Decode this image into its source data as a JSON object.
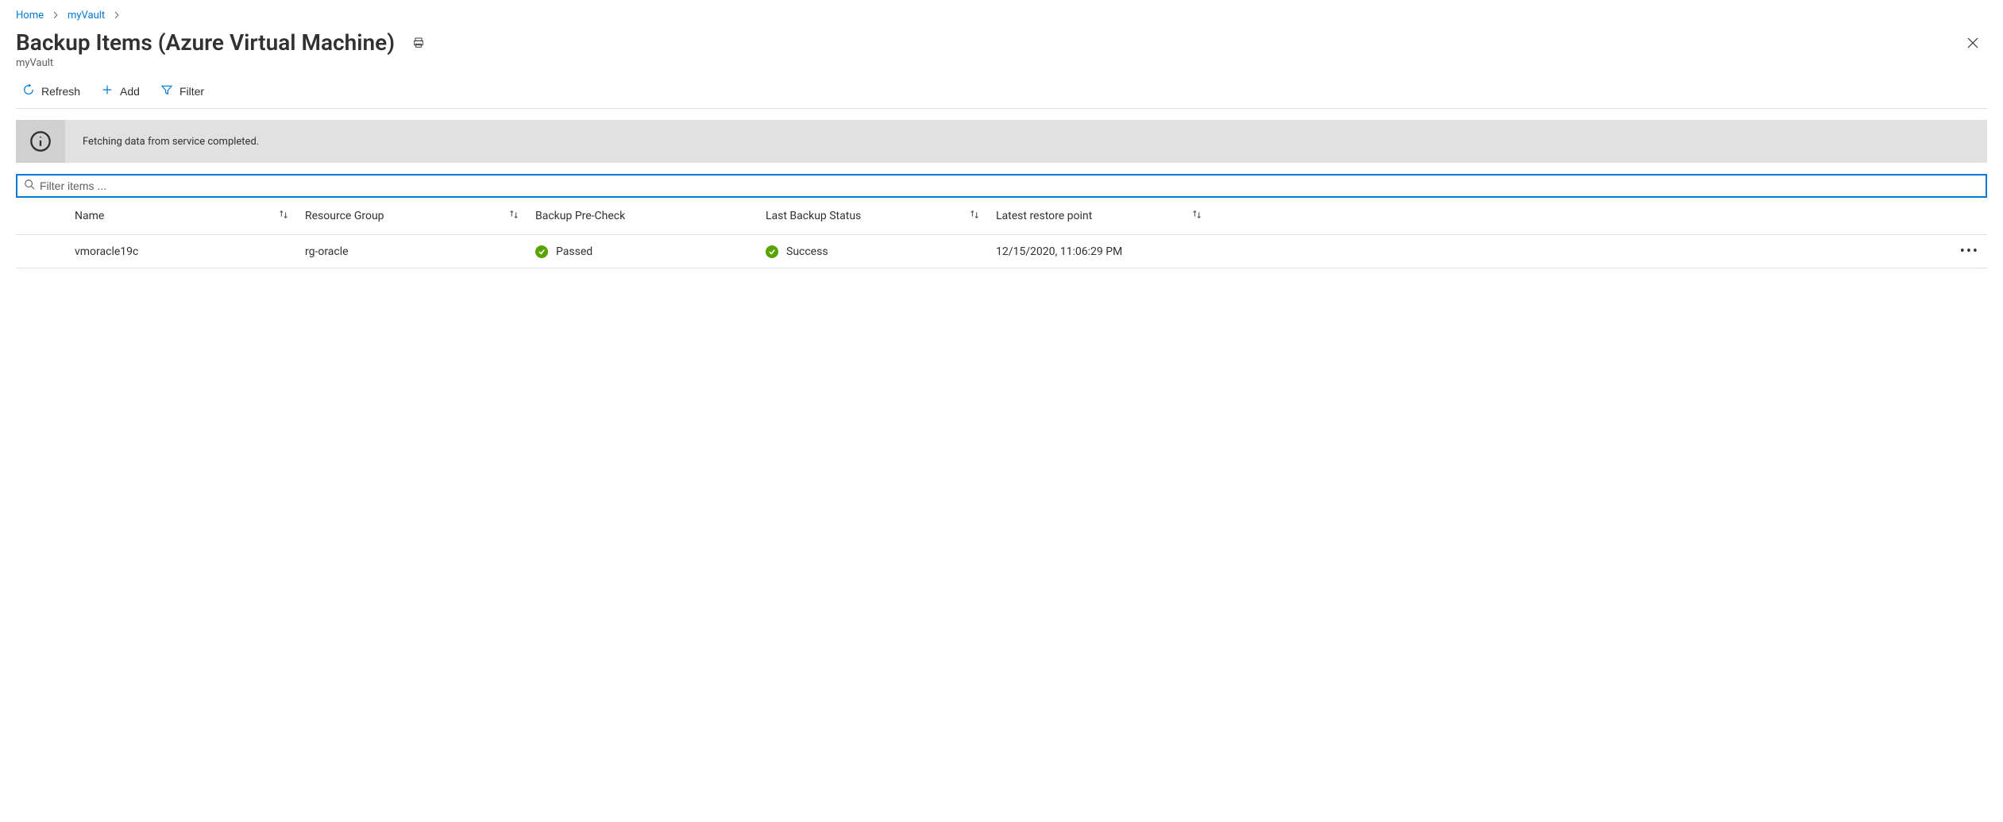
{
  "breadcrumb": {
    "home": "Home",
    "vault": "myVault"
  },
  "header": {
    "title": "Backup Items (Azure Virtual Machine)",
    "subtitle": "myVault"
  },
  "toolbar": {
    "refresh": "Refresh",
    "add": "Add",
    "filter": "Filter"
  },
  "notification": {
    "message": "Fetching data from service completed."
  },
  "filter": {
    "placeholder": "Filter items ..."
  },
  "columns": {
    "name": "Name",
    "resource_group": "Resource Group",
    "precheck": "Backup Pre-Check",
    "last_status": "Last Backup Status",
    "restore_point": "Latest restore point"
  },
  "rows": [
    {
      "name": "vmoracle19c",
      "resource_group": "rg-oracle",
      "precheck_status": "Passed",
      "last_backup_status": "Success",
      "latest_restore_point": "12/15/2020, 11:06:29 PM"
    }
  ],
  "colors": {
    "accent": "#0078d4",
    "success": "#57a300"
  }
}
